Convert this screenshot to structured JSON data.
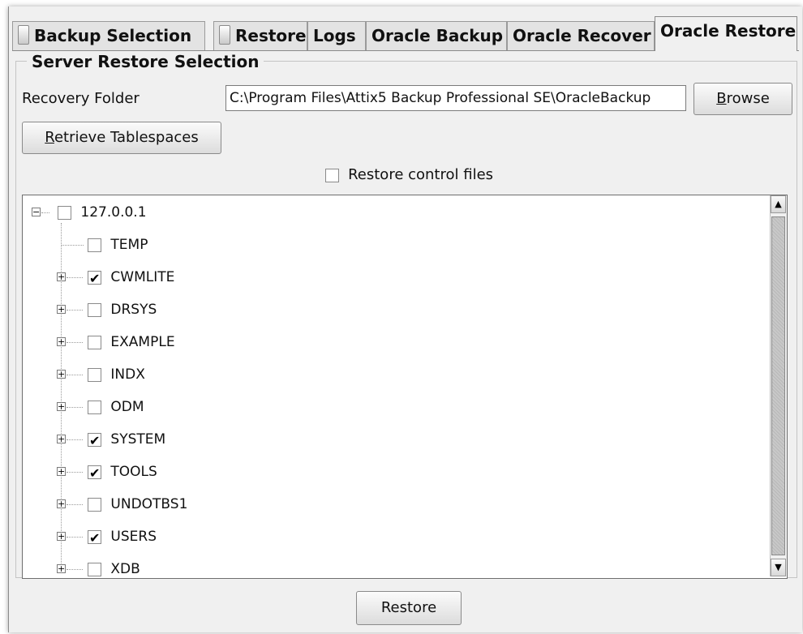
{
  "tabs": [
    {
      "label": "Backup Selection",
      "icon": "document-icon",
      "active": false
    },
    {
      "label": "Restore",
      "icon": "document-icon",
      "active": false
    },
    {
      "label": "Logs",
      "active": false
    },
    {
      "label": "Oracle Backup",
      "active": false
    },
    {
      "label": "Oracle Recover",
      "active": false
    },
    {
      "label": "Oracle Restore",
      "active": true
    }
  ],
  "group": {
    "title": "Server Restore Selection"
  },
  "recovery": {
    "label": "Recovery Folder",
    "value": "C:\\Program Files\\Attix5 Backup Professional SE\\OracleBackup",
    "browse_label_u": "B",
    "browse_label_rest": "rowse"
  },
  "retrieve": {
    "label_u": "R",
    "label_rest": "etrieve Tablespaces"
  },
  "restore_control": {
    "label": "Restore control files",
    "checked": false
  },
  "tree": {
    "root": {
      "label": "127.0.0.1",
      "checked": false,
      "expanded": true
    },
    "items": [
      {
        "label": "TEMP",
        "checked": false,
        "has_children": false
      },
      {
        "label": "CWMLITE",
        "checked": true,
        "has_children": true
      },
      {
        "label": "DRSYS",
        "checked": false,
        "has_children": true
      },
      {
        "label": "EXAMPLE",
        "checked": false,
        "has_children": true
      },
      {
        "label": "INDX",
        "checked": false,
        "has_children": true
      },
      {
        "label": "ODM",
        "checked": false,
        "has_children": true
      },
      {
        "label": "SYSTEM",
        "checked": true,
        "has_children": true
      },
      {
        "label": "TOOLS",
        "checked": true,
        "has_children": true
      },
      {
        "label": "UNDOTBS1",
        "checked": false,
        "has_children": true
      },
      {
        "label": "USERS",
        "checked": true,
        "has_children": true
      },
      {
        "label": "XDB",
        "checked": false,
        "has_children": true
      }
    ]
  },
  "footer": {
    "restore_label": "Restore"
  }
}
